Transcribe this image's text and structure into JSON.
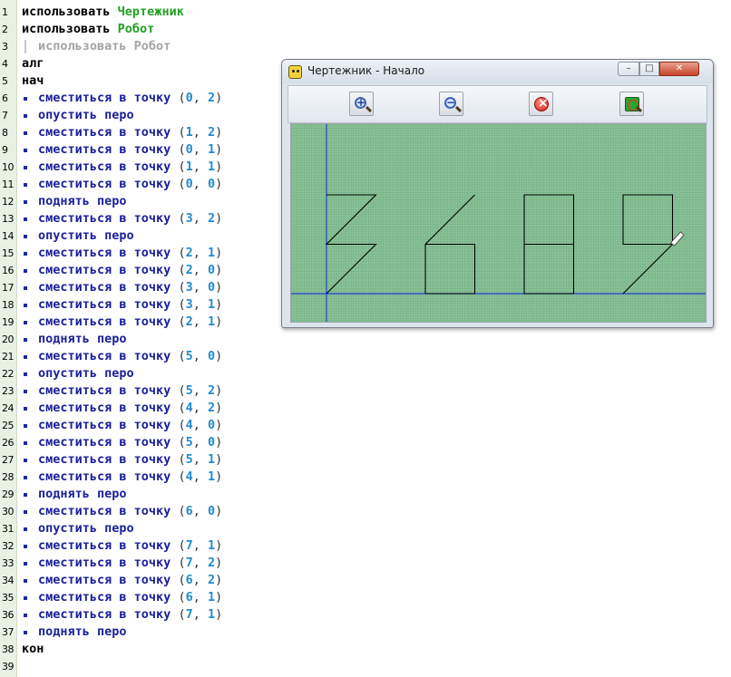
{
  "editor": {
    "lines": [
      {
        "n": "1",
        "parts": [
          {
            "t": "использовать ",
            "c": "kw"
          },
          {
            "t": "Чертежник",
            "c": "mod"
          }
        ]
      },
      {
        "n": "2",
        "parts": [
          {
            "t": "использовать ",
            "c": "kw"
          },
          {
            "t": "Робот",
            "c": "mod"
          }
        ]
      },
      {
        "n": "3",
        "comment": true,
        "parts": [
          {
            "t": "использовать Робот",
            "c": "faded"
          }
        ]
      },
      {
        "n": "4",
        "parts": [
          {
            "t": "алг",
            "c": "kw"
          }
        ]
      },
      {
        "n": "5",
        "parts": [
          {
            "t": "нач",
            "c": "kw"
          }
        ]
      },
      {
        "n": "6",
        "cmd": "сместиться в точку",
        "args": [
          "0",
          "2"
        ]
      },
      {
        "n": "7",
        "cmd": "опустить перо"
      },
      {
        "n": "8",
        "cmd": "сместиться в точку",
        "args": [
          "1",
          "2"
        ]
      },
      {
        "n": "9",
        "cmd": "сместиться в точку",
        "args": [
          "0",
          "1"
        ]
      },
      {
        "n": "10",
        "cmd": "сместиться в точку",
        "args": [
          "1",
          "1"
        ]
      },
      {
        "n": "11",
        "cmd": "сместиться в точку",
        "args": [
          "0",
          "0"
        ]
      },
      {
        "n": "12",
        "cmd": "поднять перо"
      },
      {
        "n": "13",
        "cmd": "сместиться в точку",
        "args": [
          "3",
          "2"
        ]
      },
      {
        "n": "14",
        "cmd": "опустить перо"
      },
      {
        "n": "15",
        "cmd": "сместиться в точку",
        "args": [
          "2",
          "1"
        ]
      },
      {
        "n": "16",
        "cmd": "сместиться в точку",
        "args": [
          "2",
          "0"
        ]
      },
      {
        "n": "17",
        "cmd": "сместиться в точку",
        "args": [
          "3",
          "0"
        ]
      },
      {
        "n": "18",
        "cmd": "сместиться в точку",
        "args": [
          "3",
          "1"
        ]
      },
      {
        "n": "19",
        "cmd": "сместиться в точку",
        "args": [
          "2",
          "1"
        ]
      },
      {
        "n": "20",
        "cmd": "поднять перо"
      },
      {
        "n": "21",
        "cmd": "сместиться в точку",
        "args": [
          "5",
          "0"
        ]
      },
      {
        "n": "22",
        "cmd": "опустить перо"
      },
      {
        "n": "23",
        "cmd": "сместиться в точку",
        "args": [
          "5",
          "2"
        ]
      },
      {
        "n": "24",
        "cmd": "сместиться в точку",
        "args": [
          "4",
          "2"
        ]
      },
      {
        "n": "25",
        "cmd": "сместиться в точку",
        "args": [
          "4",
          "0"
        ]
      },
      {
        "n": "26",
        "cmd": "сместиться в точку",
        "args": [
          "5",
          "0"
        ]
      },
      {
        "n": "27",
        "cmd": "сместиться в точку",
        "args": [
          "5",
          "1"
        ]
      },
      {
        "n": "28",
        "cmd": "сместиться в точку",
        "args": [
          "4",
          "1"
        ]
      },
      {
        "n": "29",
        "cmd": "поднять перо"
      },
      {
        "n": "30",
        "cmd": "сместиться в точку",
        "args": [
          "6",
          "0"
        ]
      },
      {
        "n": "31",
        "cmd": "опустить перо"
      },
      {
        "n": "32",
        "cmd": "сместиться в точку",
        "args": [
          "7",
          "1"
        ]
      },
      {
        "n": "33",
        "cmd": "сместиться в точку",
        "args": [
          "7",
          "2"
        ]
      },
      {
        "n": "34",
        "cmd": "сместиться в точку",
        "args": [
          "6",
          "2"
        ]
      },
      {
        "n": "35",
        "cmd": "сместиться в точку",
        "args": [
          "6",
          "1"
        ]
      },
      {
        "n": "36",
        "cmd": "сместиться в точку",
        "args": [
          "7",
          "1"
        ]
      },
      {
        "n": "37",
        "cmd": "поднять перо"
      },
      {
        "n": "38",
        "parts": [
          {
            "t": "кон",
            "c": "kw"
          }
        ]
      },
      {
        "n": "39",
        "parts": []
      }
    ]
  },
  "window": {
    "title": "Чертежник - Начало",
    "min_label": "–",
    "max_label": "□",
    "close_label": "✕",
    "tools": [
      {
        "name": "zoom-in",
        "sign": "+"
      },
      {
        "name": "zoom-out",
        "sign": "−"
      },
      {
        "name": "stop"
      },
      {
        "name": "fit"
      }
    ]
  },
  "drawing": {
    "background": "#8dc39a",
    "grid_color": "#75b084",
    "axis_color": "#1e3ccf",
    "pen_color": "#000000",
    "strokes": [
      [
        [
          0,
          2
        ],
        [
          1,
          2
        ],
        [
          0,
          1
        ],
        [
          1,
          1
        ],
        [
          0,
          0
        ]
      ],
      [
        [
          3,
          2
        ],
        [
          2,
          1
        ],
        [
          2,
          0
        ],
        [
          3,
          0
        ],
        [
          3,
          1
        ],
        [
          2,
          1
        ]
      ],
      [
        [
          5,
          0
        ],
        [
          5,
          2
        ],
        [
          4,
          2
        ],
        [
          4,
          0
        ],
        [
          5,
          0
        ],
        [
          5,
          1
        ],
        [
          4,
          1
        ]
      ],
      [
        [
          6,
          0
        ],
        [
          7,
          1
        ],
        [
          7,
          2
        ],
        [
          6,
          2
        ],
        [
          6,
          1
        ],
        [
          7,
          1
        ]
      ]
    ],
    "pen_position": [
      7,
      1
    ]
  },
  "colors": {
    "keyword": "#000000",
    "command": "#1a2099",
    "module": "#22a022",
    "number": "#1e8bd2",
    "comment": "#a4a4a4"
  }
}
